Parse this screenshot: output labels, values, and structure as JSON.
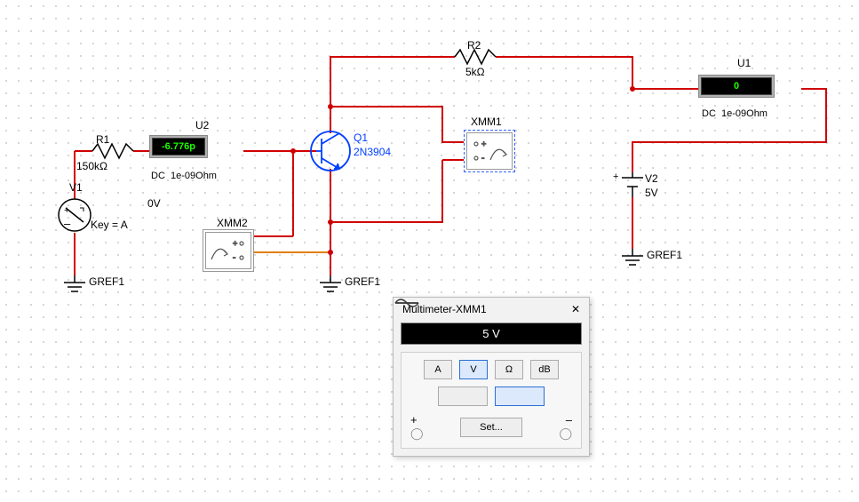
{
  "components": {
    "R1": {
      "name": "R1",
      "value": "150kΩ"
    },
    "R2": {
      "name": "R2",
      "value": "5kΩ"
    },
    "V1": {
      "name": "V1",
      "key": "Key = A",
      "annotation": "0V"
    },
    "V2": {
      "name": "V2",
      "value": "5V"
    },
    "Q1": {
      "name": "Q1",
      "model": "2N3904"
    },
    "U1": {
      "name": "U1",
      "reading": "0",
      "meta": "DC  1e-09Ohm"
    },
    "U2": {
      "name": "U2",
      "reading": "-6.776p",
      "meta": "DC  1e-09Ohm"
    },
    "XMM1": {
      "name": "XMM1"
    },
    "XMM2": {
      "name": "XMM2"
    },
    "GREF": {
      "name": "GREF1"
    }
  },
  "multimeter_dialog": {
    "title": "Multimeter-XMM1",
    "reading": "5 V",
    "buttons": {
      "A": "A",
      "V": "V",
      "Ohm": "Ω",
      "dB": "dB"
    },
    "active_mode": "V",
    "active_wave": "dc",
    "set_label": "Set...",
    "plus": "+",
    "minus": "–"
  }
}
